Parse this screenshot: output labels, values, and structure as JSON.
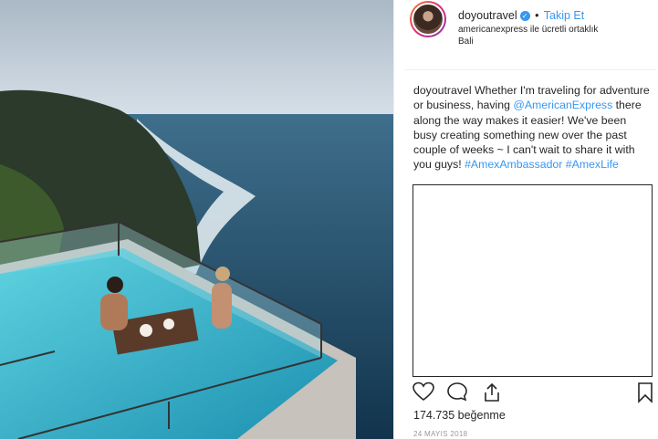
{
  "post": {
    "username": "doyoutravel",
    "follow_label": "Takip Et",
    "dot": "•",
    "partnership": "americanexpress ile ücretli ortaklık",
    "location": "Bali",
    "caption": {
      "author": "doyoutravel",
      "text_1": " Whether I'm traveling for adventure or business, having ",
      "mention": "@AmericanExpress",
      "text_2": " there along the way makes it easier! We've been busy creating something new over the past couple of weeks ~ I can't wait to share it with you guys! ",
      "tag_1": "#AmexAmbassador",
      "tag_2": "#AmexLife"
    },
    "likes": "174.735 beğenme",
    "date": "24 MAYIS 2018"
  },
  "icons": {
    "verified": "verified-badge-icon",
    "like": "heart-icon",
    "comment": "comment-icon",
    "share": "share-icon",
    "save": "bookmark-icon"
  },
  "colors": {
    "link": "#3897f0",
    "text": "#262626",
    "muted": "#999999"
  }
}
